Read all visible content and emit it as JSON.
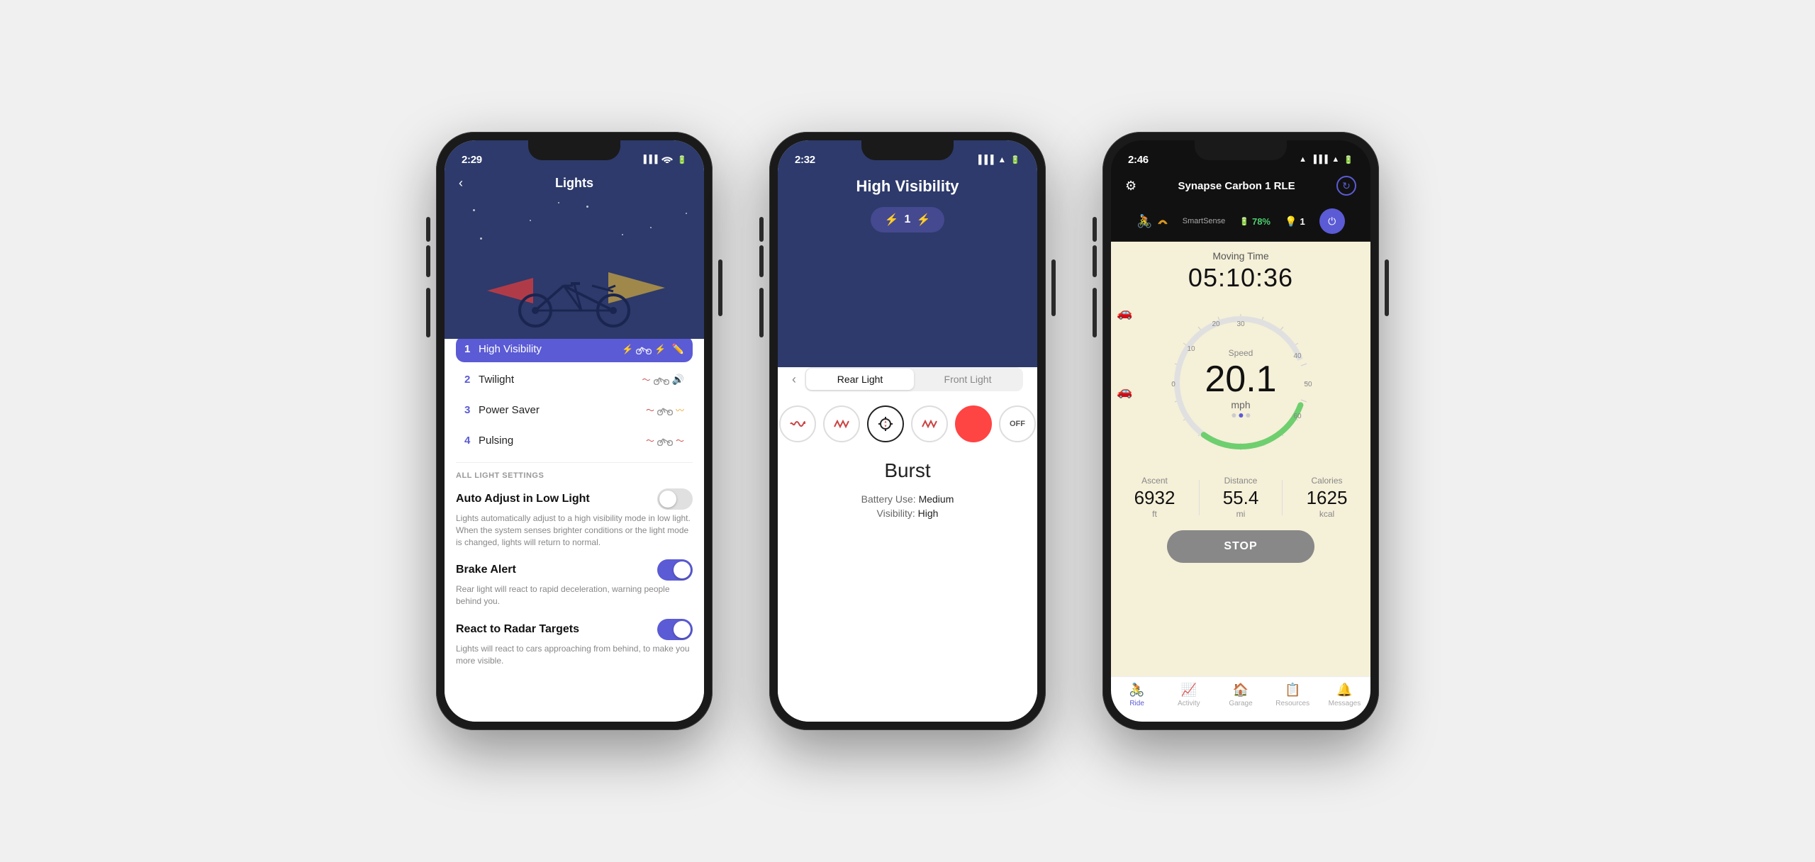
{
  "phone1": {
    "status": {
      "time": "2:29",
      "battery": "100"
    },
    "title": "Lights",
    "modes": [
      {
        "num": "1",
        "name": "High Visibility",
        "active": true,
        "icons": "⚡🚴⚡"
      },
      {
        "num": "2",
        "name": "Twilight",
        "active": false,
        "icons": "〜🚴🔊"
      },
      {
        "num": "3",
        "name": "Power Saver",
        "active": false,
        "icons": "〜🚴〰"
      },
      {
        "num": "4",
        "name": "Pulsing",
        "active": false,
        "icons": "〜🚴〜"
      }
    ],
    "section_label": "ALL LIGHT SETTINGS",
    "settings": [
      {
        "title": "Auto Adjust in Low Light",
        "desc": "Lights automatically adjust to a high visibility mode in low light. When the system senses brighter conditions or the light mode is changed, lights will return to normal.",
        "toggle": "off"
      },
      {
        "title": "Brake Alert",
        "desc": "Rear light will react to rapid deceleration, warning people behind you.",
        "toggle": "on"
      },
      {
        "title": "React to Radar Targets",
        "desc": "Lights will react to cars approaching from behind, to make you more visible.",
        "toggle": "on"
      }
    ]
  },
  "phone2": {
    "status": {
      "time": "2:32"
    },
    "title": "High Visibility",
    "badge_num": "1",
    "tabs": [
      "Rear Light",
      "Front Light"
    ],
    "active_tab": "Rear Light",
    "mode_options": [
      "wave",
      "mountain",
      "burst",
      "mountain2",
      "dot",
      "off"
    ],
    "active_mode": "burst",
    "mode_label": "Burst",
    "battery_use_label": "Battery Use:",
    "battery_use_val": "Medium",
    "visibility_label": "Visibility:",
    "visibility_val": "High"
  },
  "phone3": {
    "status": {
      "time": "2:46"
    },
    "device_name": "Synapse Carbon 1 RLE",
    "smart_sense_label": "SmartSense",
    "battery_pct": "78%",
    "light_num": "1",
    "moving_time_label": "Moving Time",
    "moving_time": "05:10:36",
    "speed_label": "Speed",
    "speed_value": "20.1",
    "speed_unit": "mph",
    "stats": [
      {
        "label": "Ascent",
        "value": "6932",
        "unit": "ft"
      },
      {
        "label": "Distance",
        "value": "55.4",
        "unit": "mi"
      },
      {
        "label": "Calories",
        "value": "1625",
        "unit": "kcal"
      }
    ],
    "stop_btn": "STOP",
    "nav_items": [
      {
        "label": "Ride",
        "icon": "🚴",
        "active": true
      },
      {
        "label": "Activity",
        "icon": "📈",
        "active": false
      },
      {
        "label": "Garage",
        "icon": "🏠",
        "active": false
      },
      {
        "label": "Resources",
        "icon": "📋",
        "active": false
      },
      {
        "label": "Messages",
        "icon": "🔔",
        "active": false
      }
    ]
  }
}
